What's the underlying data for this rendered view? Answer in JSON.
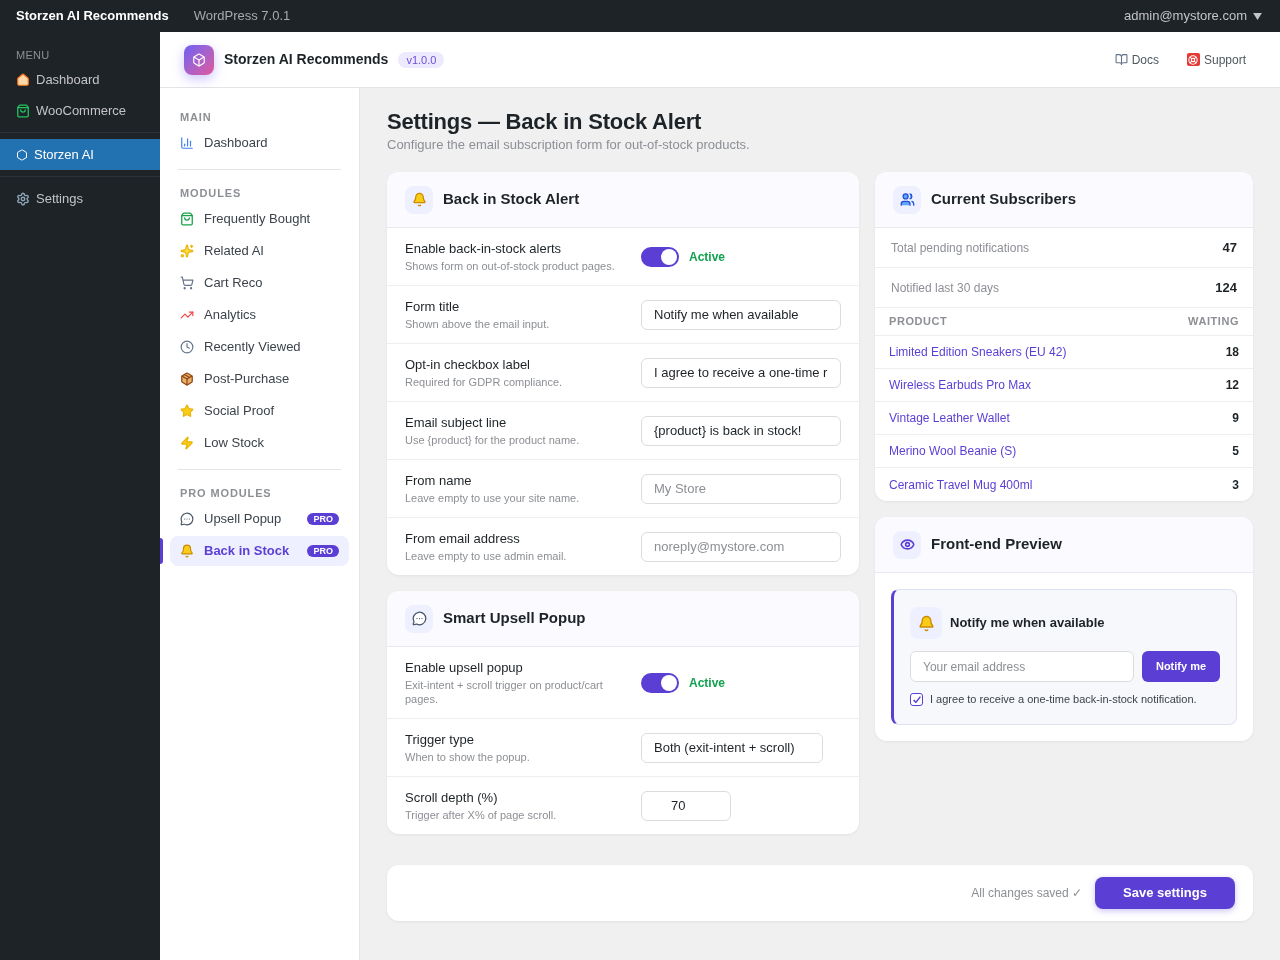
{
  "top_bar": {
    "site_title": "Storzen AI Recommends",
    "platform": "WordPress 7.0.1",
    "user": "admin@mystore.com"
  },
  "wp_menu": {
    "heading": "MENU",
    "groups": [
      {
        "items": [
          {
            "label": "Dashboard",
            "selected": false
          },
          {
            "label": "WooCommerce",
            "selected": false
          }
        ]
      },
      {
        "items": [
          {
            "label": "Storzen AI",
            "selected": true
          }
        ]
      },
      {
        "items": [
          {
            "label": "Settings",
            "selected": false
          }
        ]
      }
    ]
  },
  "plugin_header": {
    "title": "Storzen AI Recommends",
    "version": "v1.0.0",
    "links": [
      "Docs",
      "Support"
    ]
  },
  "plugin_nav": {
    "sections": [
      {
        "heading": "MAIN",
        "items": [
          {
            "label": "Dashboard",
            "selected": false
          }
        ]
      },
      {
        "heading": "MODULES",
        "items": [
          {
            "label": "Frequently Bought",
            "selected": false
          },
          {
            "label": "Related AI",
            "selected": false
          },
          {
            "label": "Cart Reco",
            "selected": false
          },
          {
            "label": "Analytics",
            "selected": false
          },
          {
            "label": "Recently Viewed",
            "selected": false
          },
          {
            "label": "Post-Purchase",
            "selected": false
          },
          {
            "label": "Social Proof",
            "selected": false
          },
          {
            "label": "Low Stock",
            "selected": false
          }
        ]
      },
      {
        "heading": "PRO MODULES",
        "items": [
          {
            "label": "Upsell Popup",
            "badge": "PRO",
            "selected": false
          },
          {
            "label": "Back in Stock",
            "badge": "PRO",
            "selected": true
          }
        ]
      }
    ]
  },
  "page": {
    "title": "Settings — Back in Stock Alert",
    "subtitle": "Configure the email subscription form for out-of-stock products."
  },
  "settings_cards": [
    {
      "title": "Back in Stock Alert",
      "rows": [
        {
          "kind": "toggle",
          "label": "Enable back-in-stock alerts",
          "hint": "Shows form on out-of-stock product pages.",
          "on": true,
          "status": "Active"
        },
        {
          "kind": "text",
          "label": "Form title",
          "hint": "Shown above the email input.",
          "value": "Notify me when available"
        },
        {
          "kind": "text",
          "label": "Opt-in checkbox label",
          "hint": "Required for GDPR compliance.",
          "value": "I agree to receive a one-time r"
        },
        {
          "kind": "text",
          "label": "Email subject line",
          "hint": "Use {product} for the product name.",
          "value": "{product} is back in stock!"
        },
        {
          "kind": "text",
          "label": "From name",
          "hint": "Leave empty to use your site name.",
          "placeholder": "My Store"
        },
        {
          "kind": "text",
          "label": "From email address",
          "hint": "Leave empty to use admin email.",
          "placeholder": "noreply@mystore.com"
        }
      ]
    },
    {
      "title": "Smart Upsell Popup",
      "rows": [
        {
          "kind": "toggle",
          "label": "Enable upsell popup",
          "hint": "Exit-intent + scroll trigger on product/cart pages.",
          "on": true,
          "status": "Active"
        },
        {
          "kind": "select",
          "label": "Trigger type",
          "hint": "When to show the popup.",
          "value": "Both (exit-intent + scroll)"
        },
        {
          "kind": "number",
          "label": "Scroll depth (%)",
          "hint": "Trigger after X% of page scroll.",
          "value": "70"
        }
      ]
    }
  ],
  "save_bar": {
    "status": "All changes saved ✓",
    "button": "Save settings"
  },
  "subscribers": {
    "title": "Current Subscribers",
    "stats": [
      {
        "label": "Total pending notifications",
        "value": "47"
      },
      {
        "label": "Notified last 30 days",
        "value": "124"
      }
    ],
    "table": {
      "columns": [
        "PRODUCT",
        "WAITING"
      ],
      "rows": [
        {
          "product": "Limited Edition Sneakers (EU 42)",
          "waiting": "18"
        },
        {
          "product": "Wireless Earbuds Pro Max",
          "waiting": "12"
        },
        {
          "product": "Vintage Leather Wallet",
          "waiting": "9"
        },
        {
          "product": "Merino Wool Beanie (S)",
          "waiting": "5"
        },
        {
          "product": "Ceramic Travel Mug 400ml",
          "waiting": "3"
        }
      ]
    }
  },
  "preview": {
    "title": "Front-end Preview",
    "form": {
      "title": "Notify me when available",
      "email_placeholder": "Your email address",
      "button": "Notify me",
      "consent": {
        "label": "I agree to receive a one-time back-in-stock notification.",
        "checked": true
      }
    }
  }
}
